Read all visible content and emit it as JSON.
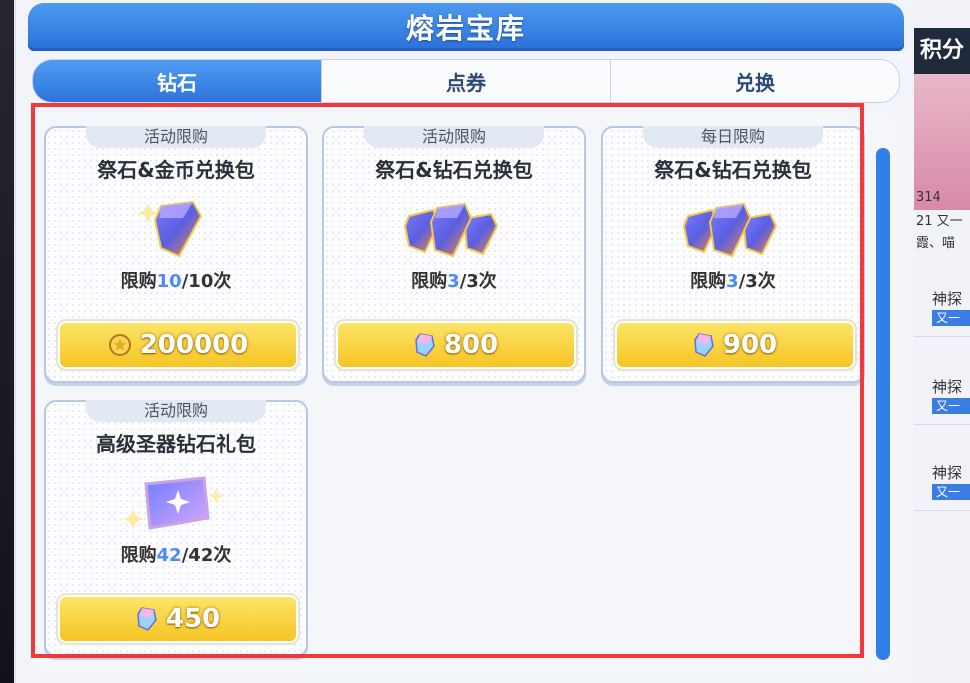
{
  "title": "熔岩宝库",
  "tabs": [
    {
      "label": "钻石",
      "active": true
    },
    {
      "label": "点券",
      "active": false
    },
    {
      "label": "兑换",
      "active": false
    }
  ],
  "items": [
    {
      "tag": "活动限购",
      "name": "祭石&金币兑换包",
      "limit_prefix": "限购",
      "limit_current": "10",
      "limit_total": "/10次",
      "price": "200000",
      "currency_icon": "gold-coin-icon"
    },
    {
      "tag": "活动限购",
      "name": "祭石&钻石兑换包",
      "limit_prefix": "限购",
      "limit_current": "3",
      "limit_total": "/3次",
      "price": "800",
      "currency_icon": "diamond-icon"
    },
    {
      "tag": "每日限购",
      "name": "祭石&钻石兑换包",
      "limit_prefix": "限购",
      "limit_current": "3",
      "limit_total": "/3次",
      "price": "900",
      "currency_icon": "diamond-icon"
    },
    {
      "tag": "活动限购",
      "name": "高级圣器钻石礼包",
      "limit_prefix": "限购",
      "limit_current": "42",
      "limit_total": "/42次",
      "price": "450",
      "currency_icon": "diamond-icon"
    }
  ],
  "side": {
    "header": "积分",
    "meta_1": "314",
    "meta_2": "21 又一",
    "meta_3": "霞、喵",
    "entries": [
      {
        "title": "神探",
        "badge": "又一"
      },
      {
        "title": "神探",
        "badge": "又一"
      },
      {
        "title": "神探",
        "badge": "又一"
      }
    ]
  },
  "colors": {
    "accent": "#2e74dc",
    "price_button": "#f5c321",
    "highlight_border": "#ee3a3c",
    "limit_current": "#4d8bf0"
  }
}
